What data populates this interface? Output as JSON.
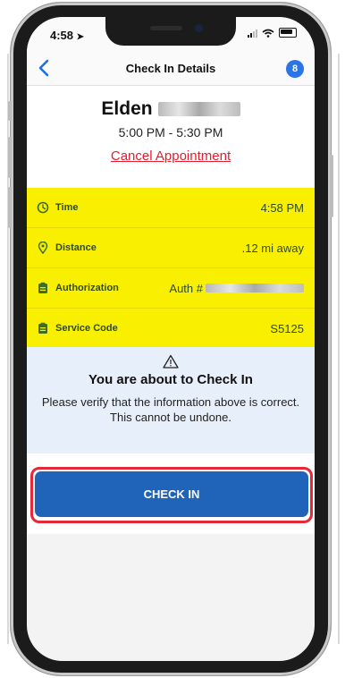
{
  "status_bar": {
    "time": "4:58"
  },
  "nav": {
    "back_icon": "chevron-left-icon",
    "title": "Check In Details",
    "badge_count": "8"
  },
  "appointment": {
    "client_name": "Elden",
    "time_range": "5:00 PM - 5:30 PM",
    "cancel_label": "Cancel Appointment"
  },
  "details": [
    {
      "icon": "clock-icon",
      "label": "Time",
      "value": "4:58 PM"
    },
    {
      "icon": "location-pin-icon",
      "label": "Distance",
      "value": ".12 mi away"
    },
    {
      "icon": "clipboard-icon",
      "label": "Authorization",
      "value": "Auth #"
    },
    {
      "icon": "clipboard-icon",
      "label": "Service Code",
      "value": "S5125"
    }
  ],
  "warning": {
    "icon": "warning-icon",
    "title": "You are about to Check In",
    "message": "Please verify that the information above is correct. This cannot be undone."
  },
  "check_in_button": {
    "label": "CHECK IN"
  },
  "colors": {
    "details_bg": "#f8f000",
    "details_text": "#2f4a1e",
    "button_bg": "#1f64b8",
    "highlight_outline": "#e5293a",
    "cancel_link": "#e02030",
    "accent_blue": "#1a6fe0",
    "warning_bg": "#e7effa"
  }
}
